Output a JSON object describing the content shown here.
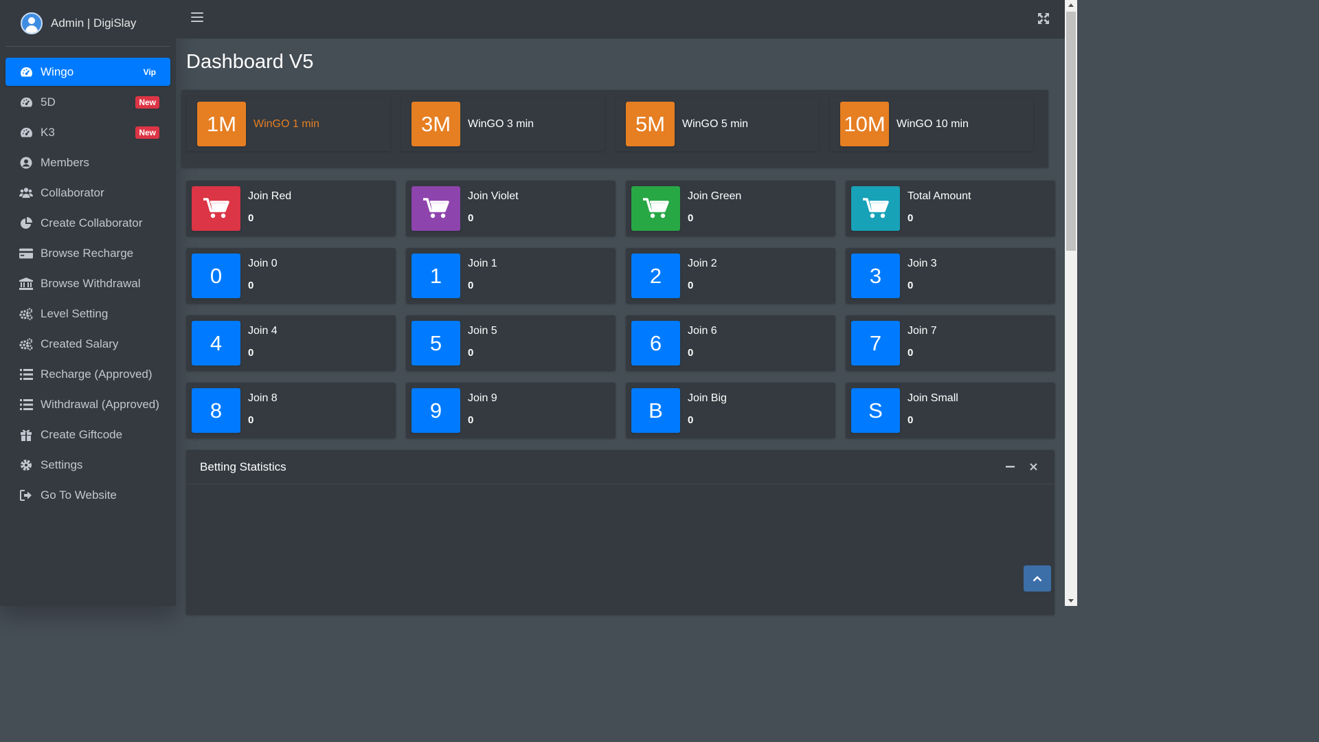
{
  "brand": {
    "title": "Admin | DigiSlay"
  },
  "sidebar": {
    "items": [
      {
        "label": "Wingo",
        "icon": "tachometer-icon",
        "badge": "Vip"
      },
      {
        "label": "5D",
        "icon": "tachometer-icon",
        "badge": "New"
      },
      {
        "label": "K3",
        "icon": "tachometer-icon",
        "badge": "New"
      },
      {
        "label": "Members",
        "icon": "user-circle-icon"
      },
      {
        "label": "Collaborator",
        "icon": "users-icon"
      },
      {
        "label": "Create Collaborator",
        "icon": "pie-chart-icon"
      },
      {
        "label": "Browse Recharge",
        "icon": "credit-card-icon"
      },
      {
        "label": "Browse Withdrawal",
        "icon": "bank-icon"
      },
      {
        "label": "Level Setting",
        "icon": "cogs-icon"
      },
      {
        "label": "Created Salary",
        "icon": "cogs-icon"
      },
      {
        "label": "Recharge (Approved)",
        "icon": "list-icon"
      },
      {
        "label": "Withdrawal (Approved)",
        "icon": "list-icon"
      },
      {
        "label": "Create Giftcode",
        "icon": "gift-icon"
      },
      {
        "label": "Settings",
        "icon": "gear-icon"
      },
      {
        "label": "Go To Website",
        "icon": "sign-out-icon"
      }
    ]
  },
  "page": {
    "title": "Dashboard V5"
  },
  "wingo": [
    {
      "code": "1M",
      "label": "WinGO 1 min"
    },
    {
      "code": "3M",
      "label": "WinGO 3 min"
    },
    {
      "code": "5M",
      "label": "WinGO 5 min"
    },
    {
      "code": "10M",
      "label": "WinGO 10 min"
    }
  ],
  "joins": [
    {
      "icon": "cart-icon",
      "label": "Join Red",
      "value": "0",
      "color": "#dc3545"
    },
    {
      "icon": "cart-icon",
      "label": "Join Violet",
      "value": "0",
      "color": "#8e44ad"
    },
    {
      "icon": "cart-icon",
      "label": "Join Green",
      "value": "0",
      "color": "#28a745"
    },
    {
      "icon": "cart-icon",
      "label": "Total Amount",
      "value": "0",
      "color": "#17a2b8"
    },
    {
      "icon": "0",
      "label": "Join 0",
      "value": "0",
      "color": "#007bff"
    },
    {
      "icon": "1",
      "label": "Join 1",
      "value": "0",
      "color": "#007bff"
    },
    {
      "icon": "2",
      "label": "Join 2",
      "value": "0",
      "color": "#007bff"
    },
    {
      "icon": "3",
      "label": "Join 3",
      "value": "0",
      "color": "#007bff"
    },
    {
      "icon": "4",
      "label": "Join 4",
      "value": "0",
      "color": "#007bff"
    },
    {
      "icon": "5",
      "label": "Join 5",
      "value": "0",
      "color": "#007bff"
    },
    {
      "icon": "6",
      "label": "Join 6",
      "value": "0",
      "color": "#007bff"
    },
    {
      "icon": "7",
      "label": "Join 7",
      "value": "0",
      "color": "#007bff"
    },
    {
      "icon": "8",
      "label": "Join 8",
      "value": "0",
      "color": "#007bff"
    },
    {
      "icon": "9",
      "label": "Join 9",
      "value": "0",
      "color": "#007bff"
    },
    {
      "icon": "B",
      "label": "Join Big",
      "value": "0",
      "color": "#007bff"
    },
    {
      "icon": "S",
      "label": "Join Small",
      "value": "0",
      "color": "#007bff"
    }
  ],
  "card": {
    "title": "Betting Statistics"
  },
  "colors": {
    "accent": "#007bff",
    "orange": "#e67e22",
    "new_badge": "#dc3545"
  }
}
